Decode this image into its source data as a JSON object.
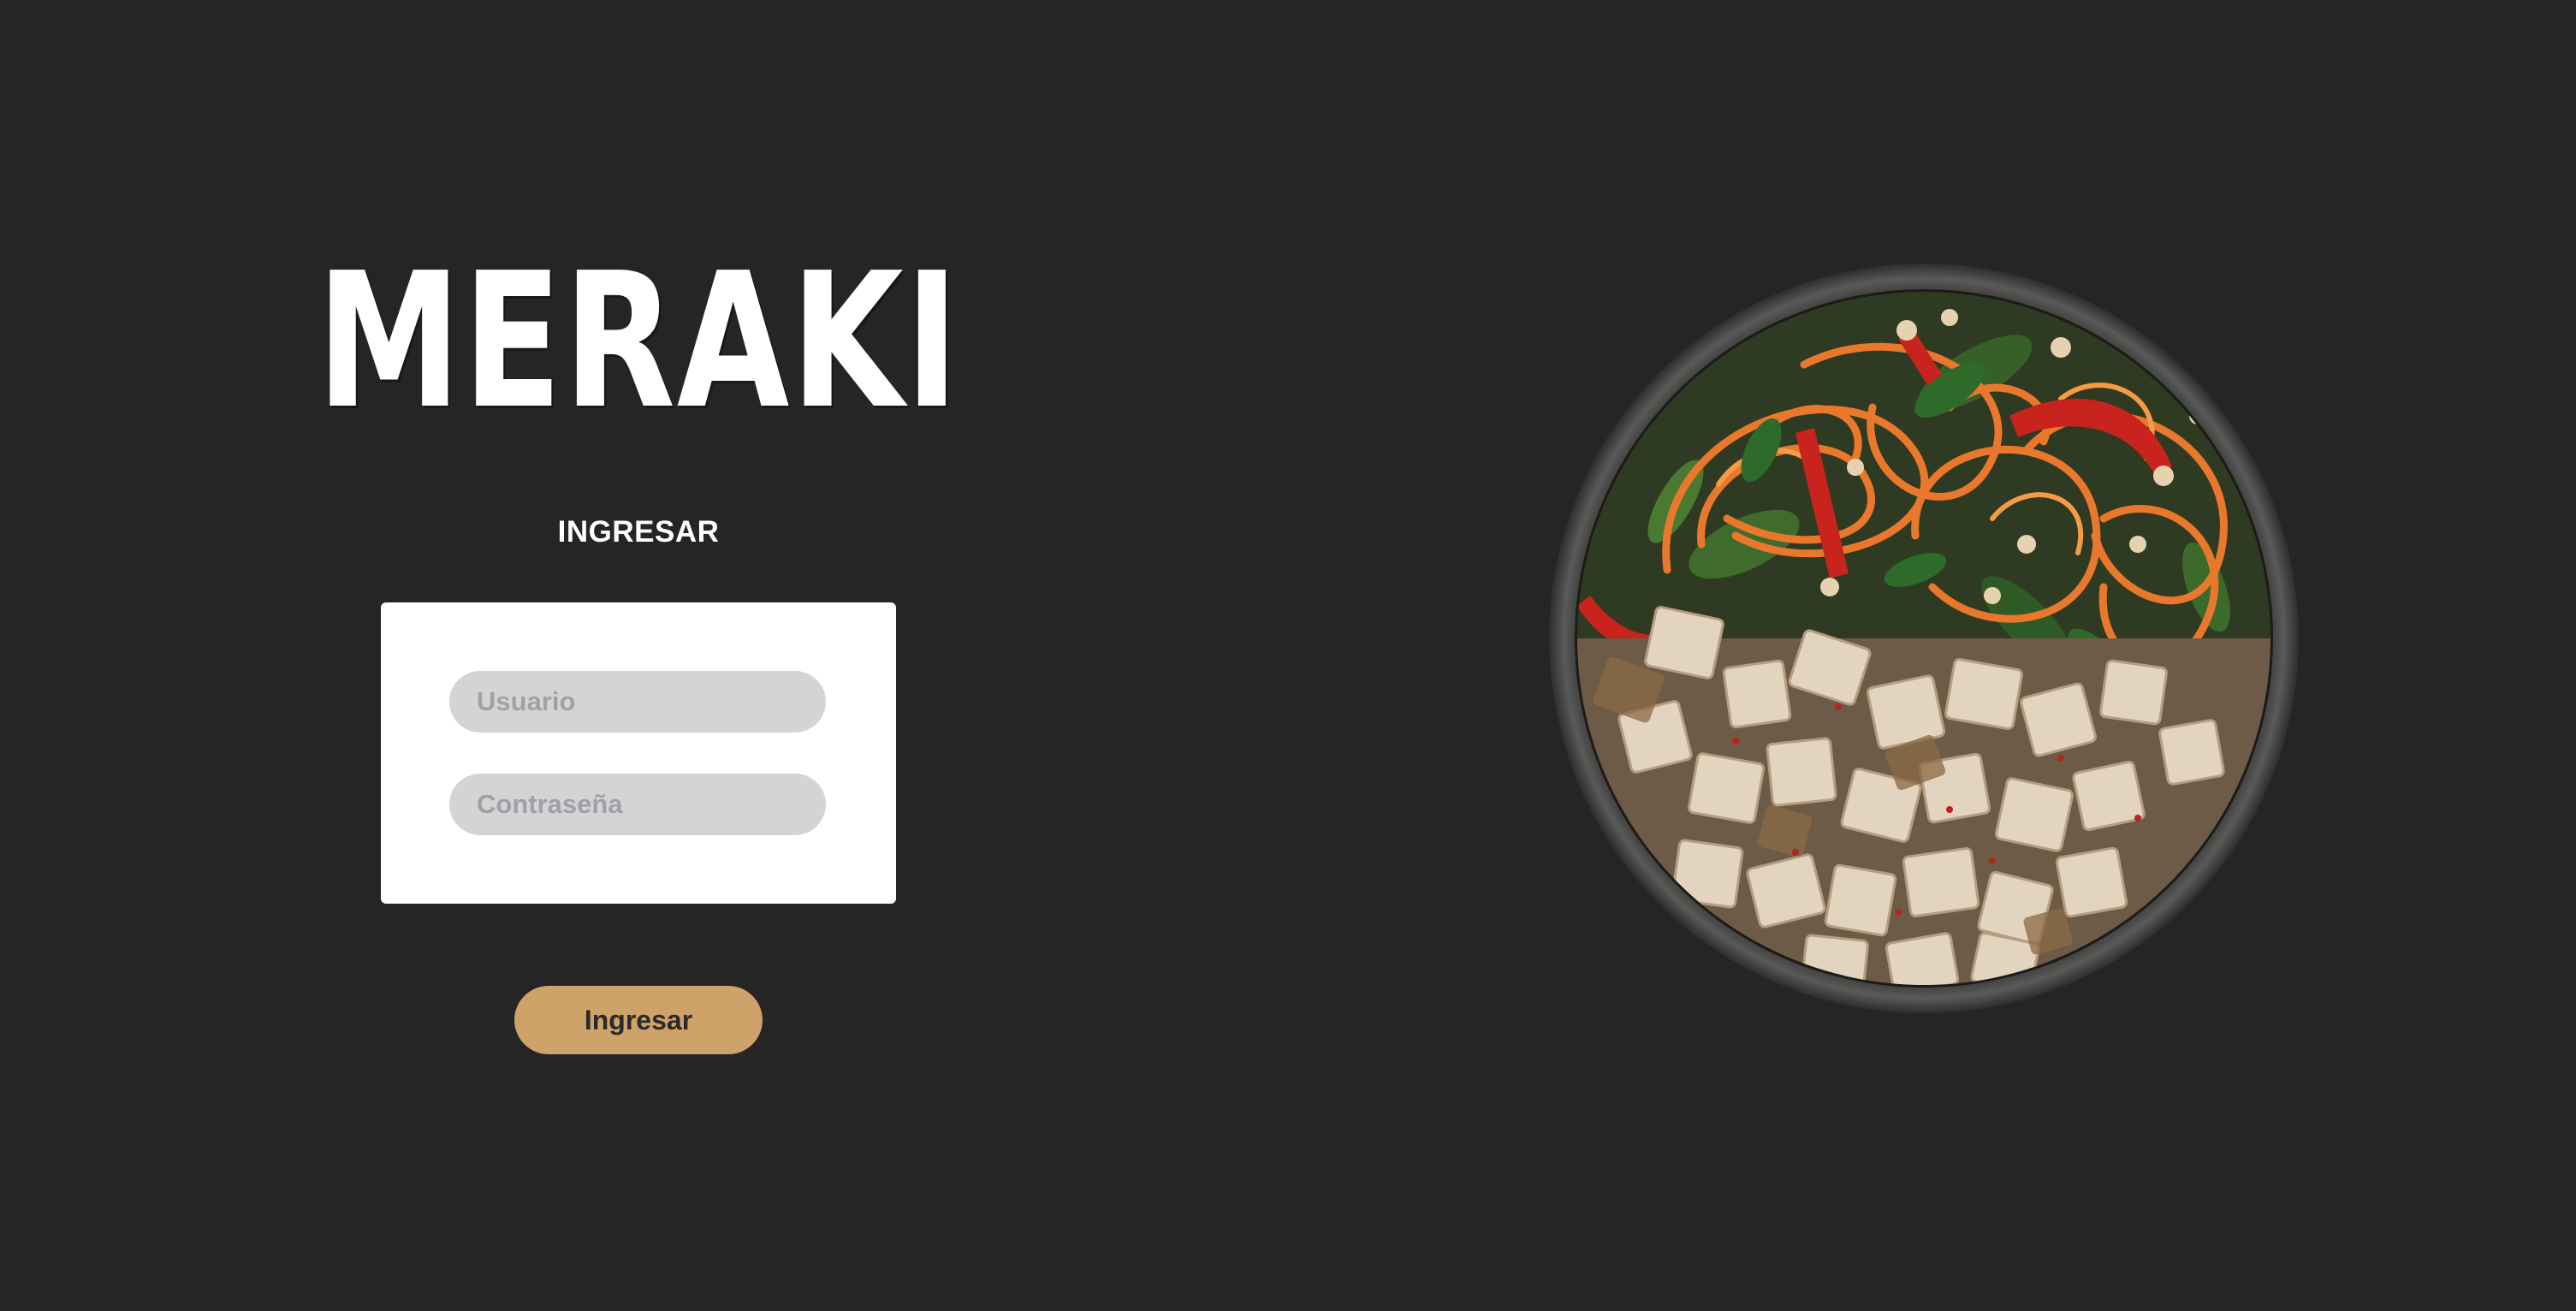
{
  "brand": {
    "logo_text": "MERAKI"
  },
  "login": {
    "heading": "INGRESAR",
    "username": {
      "value": "",
      "placeholder": "Usuario"
    },
    "password": {
      "value": "",
      "placeholder": "Contraseña"
    },
    "submit_label": "Ingresar"
  },
  "colors": {
    "background": "#252525",
    "card": "#ffffff",
    "field": "#d4d4d4",
    "placeholder": "#9ea1a8",
    "accent_button": "#cfa26a",
    "button_text": "#2a2a2a"
  },
  "hero_image": {
    "subject": "salad-bowl"
  }
}
